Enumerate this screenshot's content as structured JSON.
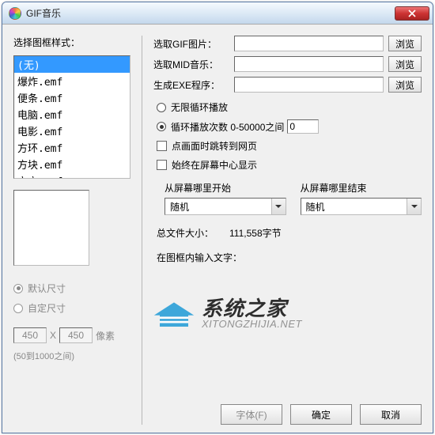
{
  "window": {
    "title": "GIF音乐"
  },
  "left": {
    "listLabel": "选择图框样式：",
    "items": [
      "(无)",
      "爆炸.emf",
      "便条.emf",
      "电脑.emf",
      "电影.emf",
      "方环.emf",
      "方块.emf",
      "立方.emf"
    ],
    "selectedIndex": 0,
    "dim": {
      "defaultLabel": "默认尺寸",
      "customLabel": "自定尺寸",
      "w": "450",
      "x": "X",
      "h": "450",
      "unit": "像素",
      "hint": "(50到1000之间)"
    }
  },
  "files": {
    "gifLabel": "选取GIF图片：",
    "midLabel": "选取MID音乐：",
    "exeLabel": "生成EXE程序：",
    "browse": "浏览"
  },
  "opts": {
    "infinite": "无限循环播放",
    "loopLabel": "循环播放次数 0-50000之间",
    "loopValue": "0",
    "jump": "点画面时跳转到网页",
    "center": "始终在屏幕中心显示"
  },
  "pos": {
    "startLabel": "从屏幕哪里开始",
    "endLabel": "从屏幕哪里结束",
    "startValue": "随机",
    "endValue": "随机"
  },
  "info": {
    "sizeLabel": "总文件大小：",
    "sizeValue": "111,558字节",
    "textLabel": "在图框内输入文字："
  },
  "footer": {
    "font": "字体(F)",
    "ok": "确定",
    "cancel": "取消"
  },
  "watermark": {
    "cn": "系统之家",
    "en": "XITONGZHIJIA.NET"
  }
}
